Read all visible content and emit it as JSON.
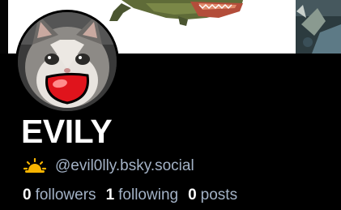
{
  "profile": {
    "display_name": "EVILY",
    "handle": "@evil0lly.bsky.social",
    "handle_emoji": "sun-behind-cloud-icon"
  },
  "stats": [
    {
      "value": "0",
      "label": "followers"
    },
    {
      "value": "1",
      "label": "following"
    },
    {
      "value": "0",
      "label": "posts"
    }
  ],
  "colors": {
    "background": "#000000",
    "name": "#ffffff",
    "secondary_text": "#a3b2c6"
  }
}
